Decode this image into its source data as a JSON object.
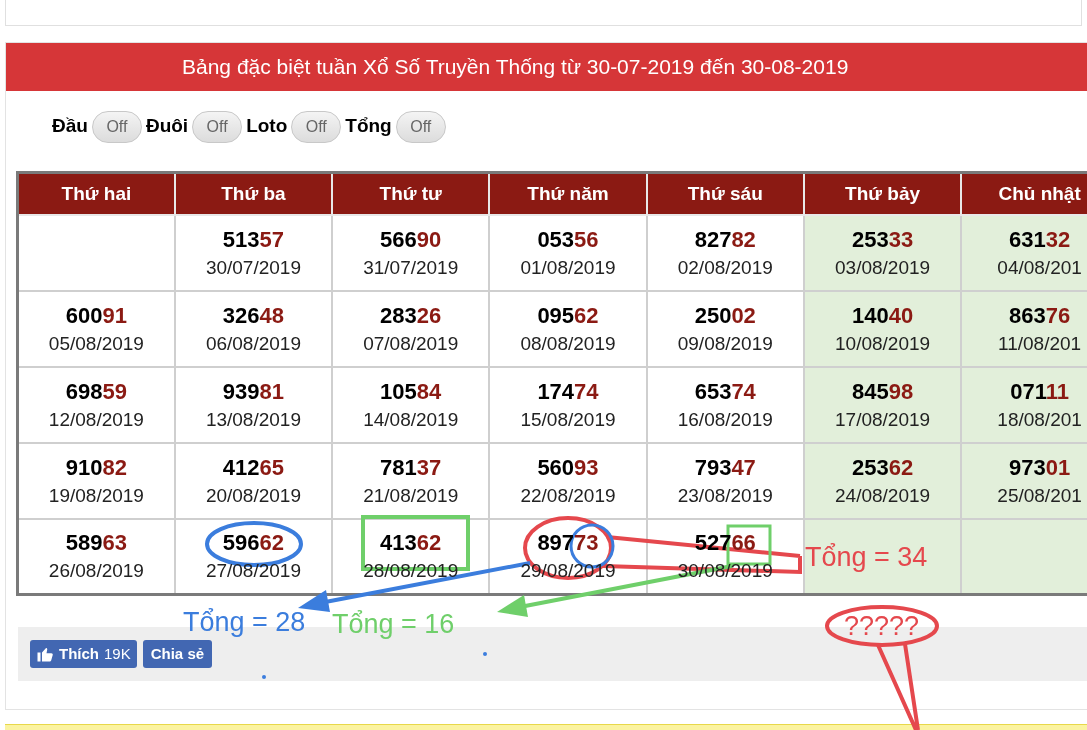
{
  "title": "Bảng đặc biệt tuần Xổ Số Truyền Thống từ 30-07-2019 đến 30-08-2019",
  "toggles": [
    {
      "label": "Đầu",
      "state": "Off",
      "on": false
    },
    {
      "label": "Đuôi",
      "state": "Off",
      "on": false
    },
    {
      "label": "Loto",
      "state": "Off",
      "on": false
    },
    {
      "label": "Tổng",
      "state": "Off",
      "on": false
    }
  ],
  "table": {
    "columns": [
      {
        "label": "Thứ hai",
        "weekend": false
      },
      {
        "label": "Thứ ba",
        "weekend": false
      },
      {
        "label": "Thứ tư",
        "weekend": false
      },
      {
        "label": "Thứ năm",
        "weekend": false
      },
      {
        "label": "Thứ sáu",
        "weekend": false
      },
      {
        "label": "Thứ bảy",
        "weekend": true
      },
      {
        "label": "Chủ nhật",
        "weekend": true
      }
    ],
    "rows": [
      [
        null,
        {
          "head": "513",
          "tail": "57",
          "date": "30/07/2019"
        },
        {
          "head": "566",
          "tail": "90",
          "date": "31/07/2019"
        },
        {
          "head": "053",
          "tail": "56",
          "date": "01/08/2019"
        },
        {
          "head": "827",
          "tail": "82",
          "date": "02/08/2019"
        },
        {
          "head": "253",
          "tail": "33",
          "date": "03/08/2019"
        },
        {
          "head": "631",
          "tail": "32",
          "date": "04/08/201"
        }
      ],
      [
        {
          "head": "600",
          "tail": "91",
          "date": "05/08/2019"
        },
        {
          "head": "326",
          "tail": "48",
          "date": "06/08/2019"
        },
        {
          "head": "283",
          "tail": "26",
          "date": "07/08/2019"
        },
        {
          "head": "095",
          "tail": "62",
          "date": "08/08/2019"
        },
        {
          "head": "250",
          "tail": "02",
          "date": "09/08/2019"
        },
        {
          "head": "140",
          "tail": "40",
          "date": "10/08/2019"
        },
        {
          "head": "863",
          "tail": "76",
          "date": "11/08/201"
        }
      ],
      [
        {
          "head": "698",
          "tail": "59",
          "date": "12/08/2019"
        },
        {
          "head": "939",
          "tail": "81",
          "date": "13/08/2019"
        },
        {
          "head": "105",
          "tail": "84",
          "date": "14/08/2019"
        },
        {
          "head": "174",
          "tail": "74",
          "date": "15/08/2019"
        },
        {
          "head": "653",
          "tail": "74",
          "date": "16/08/2019"
        },
        {
          "head": "845",
          "tail": "98",
          "date": "17/08/2019"
        },
        {
          "head": "071",
          "tail": "11",
          "date": "18/08/201"
        }
      ],
      [
        {
          "head": "910",
          "tail": "82",
          "date": "19/08/2019"
        },
        {
          "head": "412",
          "tail": "65",
          "date": "20/08/2019"
        },
        {
          "head": "781",
          "tail": "37",
          "date": "21/08/2019"
        },
        {
          "head": "560",
          "tail": "93",
          "date": "22/08/2019"
        },
        {
          "head": "793",
          "tail": "47",
          "date": "23/08/2019"
        },
        {
          "head": "253",
          "tail": "62",
          "date": "24/08/2019"
        },
        {
          "head": "973",
          "tail": "01",
          "date": "25/08/201"
        }
      ],
      [
        {
          "head": "589",
          "tail": "63",
          "date": "26/08/2019"
        },
        {
          "head": "596",
          "tail": "62",
          "date": "27/08/2019"
        },
        {
          "head": "413",
          "tail": "62",
          "date": "28/08/2019"
        },
        {
          "head": "897",
          "tail": "73",
          "date": "29/08/2019"
        },
        {
          "head": "527",
          "tail": "66",
          "date": "30/08/2019"
        },
        null,
        null
      ]
    ]
  },
  "social": {
    "like": "Thích",
    "like_count": "19K",
    "share": "Chia sẻ"
  },
  "annotations": [
    {
      "text": "Tổng = 34",
      "color": "#e5484d"
    },
    {
      "text": "Tổng = 28",
      "color": "#3b7ddd"
    },
    {
      "text": "Tổng = 16",
      "color": "#6fcf6a"
    },
    {
      "text": "?????",
      "color": "#e5484d"
    }
  ]
}
